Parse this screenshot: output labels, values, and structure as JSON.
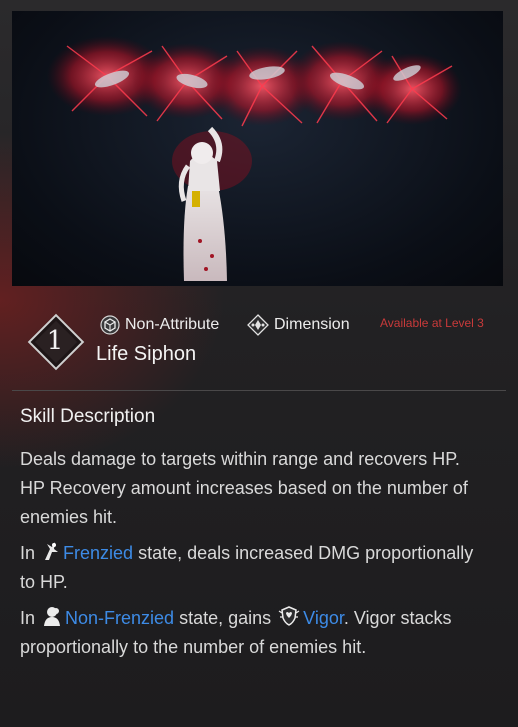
{
  "skill": {
    "level": "1",
    "attributes": [
      {
        "label": "Non-Attribute",
        "icon": "cube-attribute-icon"
      },
      {
        "label": "Dimension",
        "icon": "dimension-diamond-icon"
      }
    ],
    "availability": "Available at Level 3",
    "name": "Life Siphon"
  },
  "description": {
    "title": "Skill Description",
    "para1_line1": "Deals damage to targets within range and recovers HP.",
    "para1_line2": "HP Recovery amount increases based on the number of enemies hit.",
    "para2": {
      "prefix": "In",
      "state": "Frenzied",
      "suffix": "state, deals increased DMG proportionally to HP."
    },
    "para3": {
      "prefix": "In",
      "state": "Non-Frenzied",
      "mid": "state, gains",
      "buff": "Vigor",
      "suffix": ". Vigor stacks proportionally to the number of enemies hit."
    }
  },
  "colors": {
    "accent_blue": "#3d8be6",
    "availability_red": "#c83a3a",
    "background": "#1f1e20"
  }
}
